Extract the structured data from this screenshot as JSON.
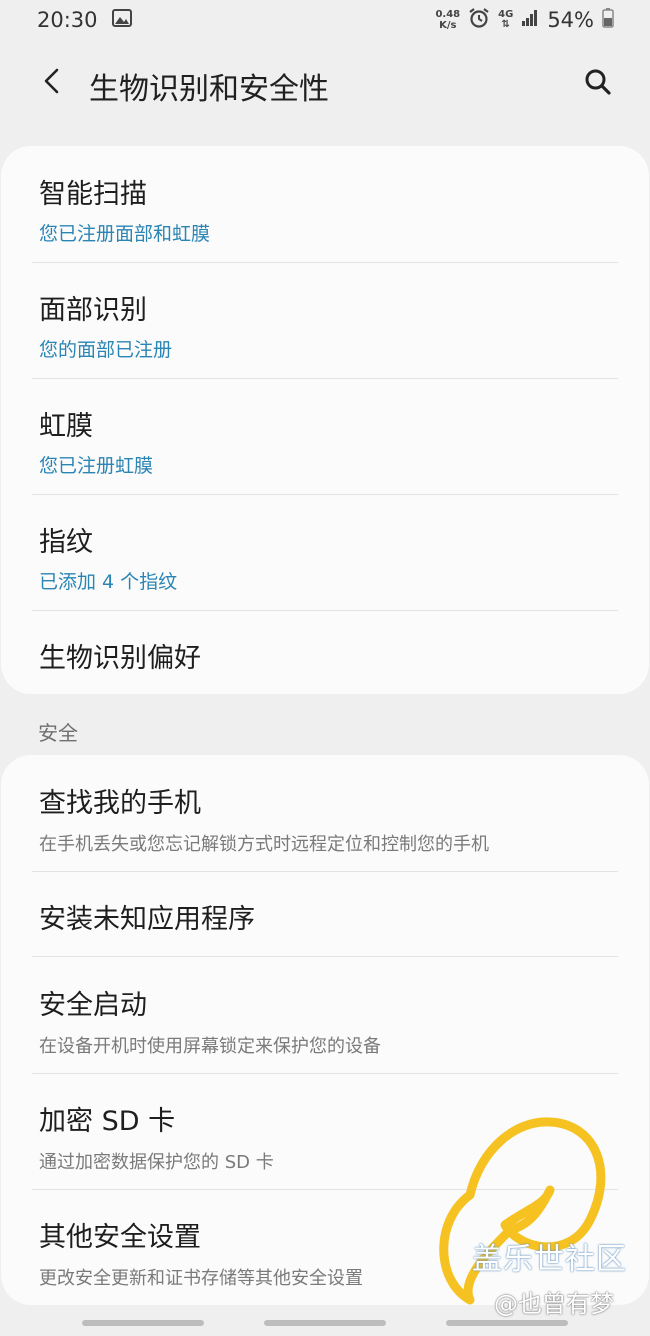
{
  "status_bar": {
    "time": "20:30",
    "net_speed_value": "0.48",
    "net_speed_unit": "K/s",
    "network_type": "4G",
    "battery": "54%"
  },
  "app_bar": {
    "title": "生物识别和安全性"
  },
  "biometrics": {
    "items": [
      {
        "title": "智能扫描",
        "subtitle": "您已注册面部和虹膜"
      },
      {
        "title": "面部识别",
        "subtitle": "您的面部已注册"
      },
      {
        "title": "虹膜",
        "subtitle": "您已注册虹膜"
      },
      {
        "title": "指纹",
        "subtitle": "已添加 4 个指纹"
      },
      {
        "title": "生物识别偏好"
      }
    ]
  },
  "security": {
    "header": "安全",
    "items": [
      {
        "title": "查找我的手机",
        "description": "在手机丢失或您忘记解锁方式时远程定位和控制您的手机"
      },
      {
        "title": "安装未知应用程序"
      },
      {
        "title": "安全启动",
        "description": "在设备开机时使用屏幕锁定来保护您的设备"
      },
      {
        "title": "加密 SD 卡",
        "description": "通过加密数据保护您的 SD 卡"
      },
      {
        "title": "其他安全设置",
        "description": "更改安全更新和证书存储等其他安全设置"
      }
    ]
  },
  "watermark": {
    "line1": "盖乐世社区",
    "line2": "@也曾有梦"
  },
  "colors": {
    "subtitle_blue": "#2a85b4",
    "background": "#efefef",
    "card": "#fbfbfb",
    "watermark_yellow": "#f5bf16"
  }
}
